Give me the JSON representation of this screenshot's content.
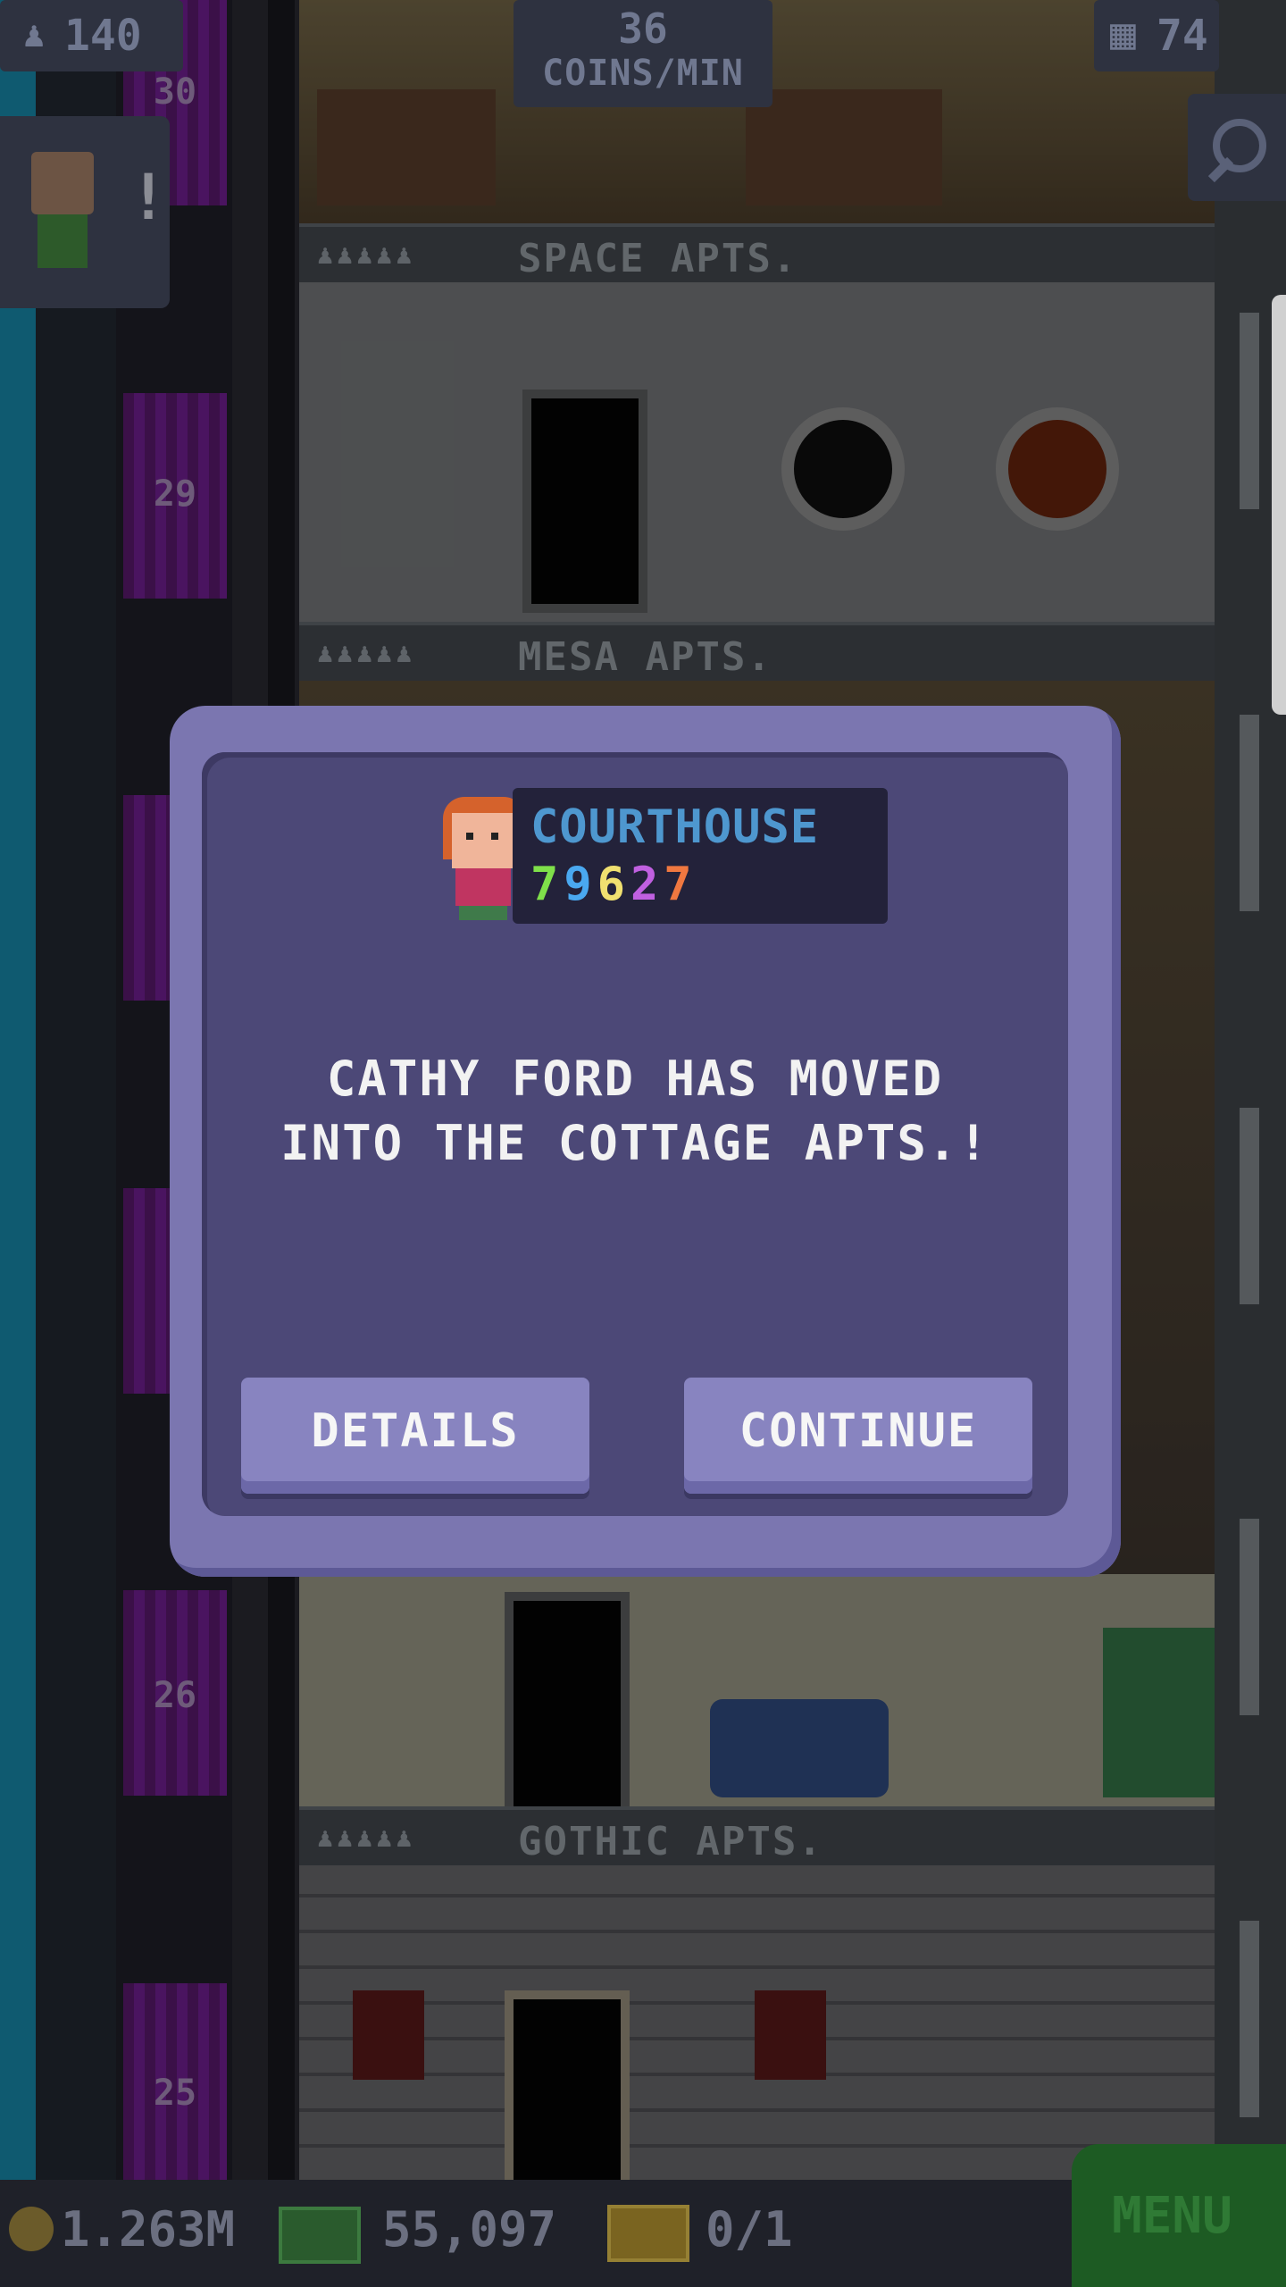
{
  "hud": {
    "population": "140",
    "coins_per_min_value": "36",
    "coins_per_min_unit": "COINS/MIN",
    "floor_count": "74"
  },
  "floors": [
    {
      "number": "30",
      "name": "SPACE APTS."
    },
    {
      "number": "29",
      "name": "MESA APTS."
    },
    {
      "number": "26",
      "name": "GOTHIC APTS."
    },
    {
      "number": "25",
      "name": ""
    }
  ],
  "elevator_numbers": [
    "30",
    "29",
    "26",
    "25"
  ],
  "dialog": {
    "business_name": "COURTHOUSE",
    "digits": [
      {
        "d": "7",
        "color": "#7fe04a"
      },
      {
        "d": "9",
        "color": "#4aa8f0"
      },
      {
        "d": "6",
        "color": "#f0e070"
      },
      {
        "d": "2",
        "color": "#c060e0"
      },
      {
        "d": "7",
        "color": "#f07840"
      }
    ],
    "message_line1": "CATHY FORD HAS MOVED",
    "message_line2": "INTO THE COTTAGE APTS.!",
    "details_label": "DETAILS",
    "continue_label": "CONTINUE"
  },
  "bottom": {
    "coins": "1.263M",
    "bux": "55,097",
    "tickets": "0/1",
    "menu_label": "MENU"
  }
}
